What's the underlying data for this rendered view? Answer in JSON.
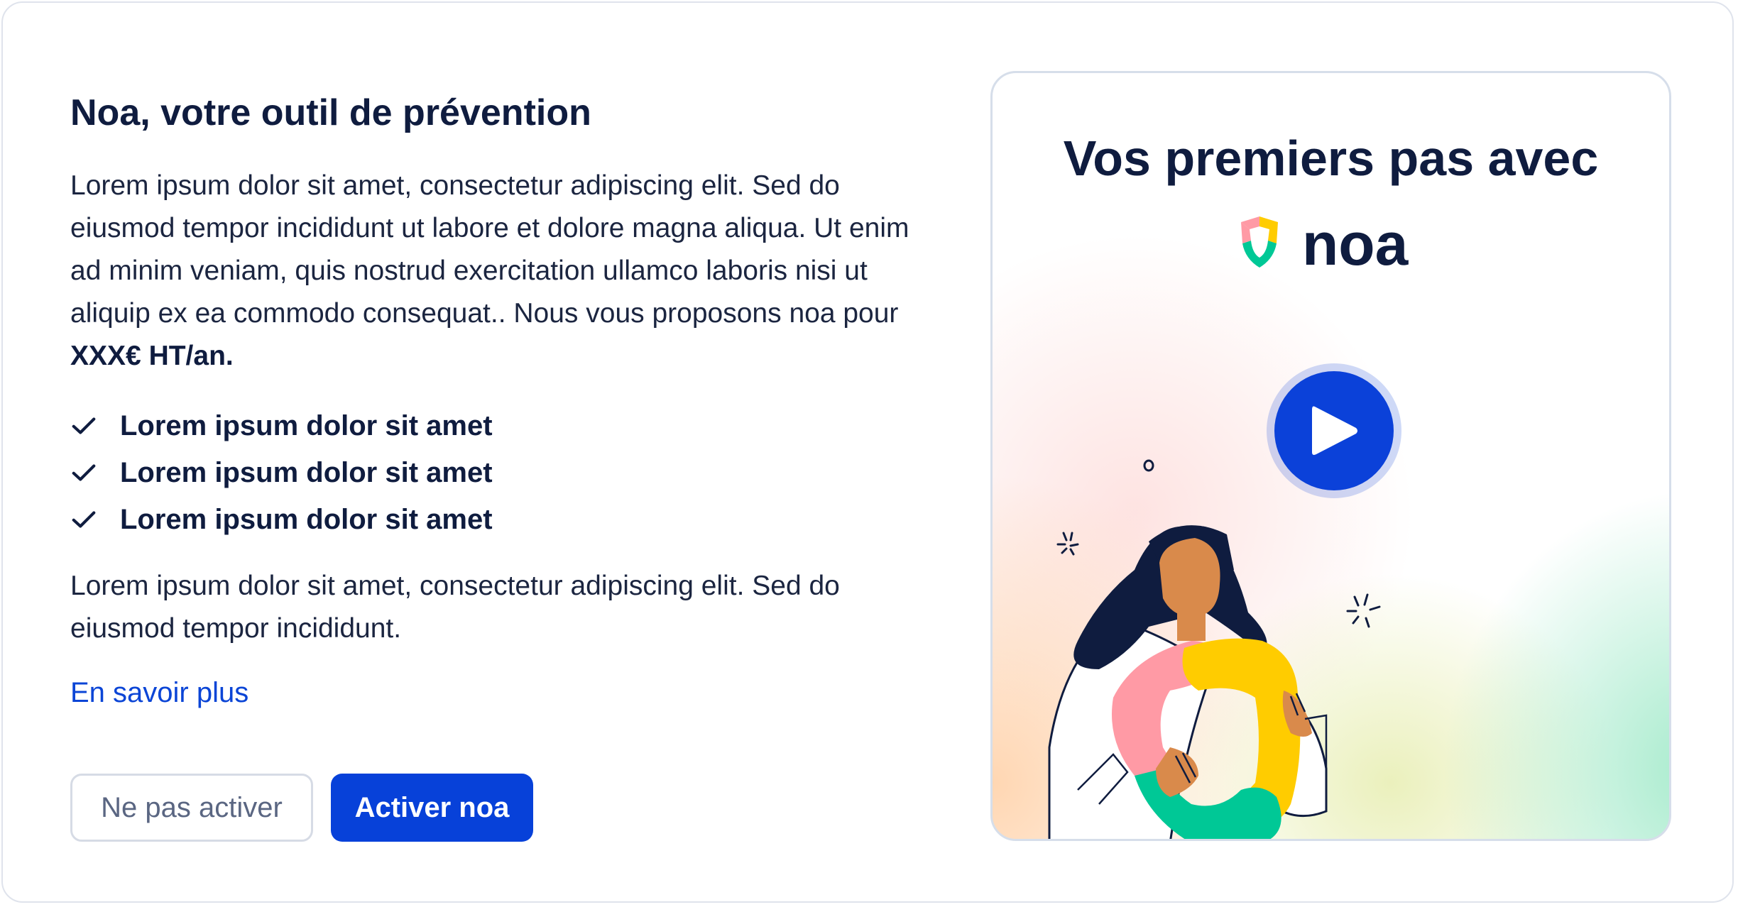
{
  "panel": {
    "title": "Noa, votre outil de prévention",
    "intro_text": "Lorem ipsum dolor sit amet, consectetur adipiscing elit. Sed do eiusmod tempor incididunt ut labore et dolore magna aliqua. Ut enim ad minim veniam, quis nostrud exercitation ullamco laboris nisi ut aliquip ex ea commodo consequat.. Nous vous proposons noa pour ",
    "price": "XXX€ HT/an.",
    "features": [
      "Lorem ipsum dolor sit amet",
      "Lorem ipsum dolor sit amet",
      "Lorem ipsum dolor sit amet"
    ],
    "outro_text": "Lorem ipsum dolor sit amet, consectetur adipiscing elit. Sed do eiusmod tempor incididunt.",
    "learn_more_link": "En savoir plus",
    "decline_button": "Ne pas activer",
    "activate_button": "Activer noa"
  },
  "video": {
    "title": "Vos premiers pas avec",
    "logo_text": "noa",
    "play_icon": "play-icon"
  },
  "colors": {
    "primary": "#0741d9",
    "text_dark": "#0f1c3f",
    "link": "#0b45d6",
    "border": "#dfe3ec"
  }
}
